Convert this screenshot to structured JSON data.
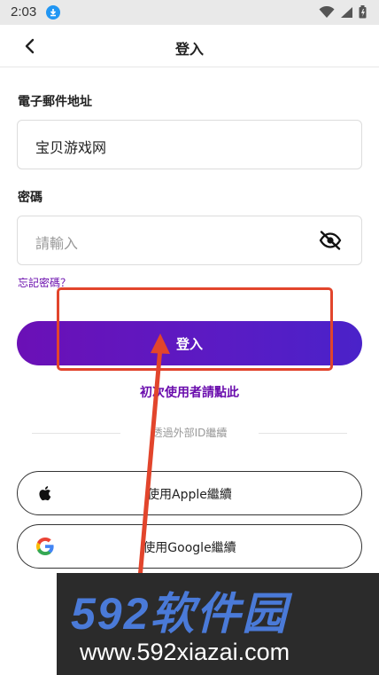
{
  "status_bar": {
    "time": "2:03"
  },
  "header": {
    "title": "登入"
  },
  "email": {
    "label": "電子郵件地址",
    "value": "宝贝游戏网"
  },
  "password": {
    "label": "密碼",
    "placeholder": "請輸入"
  },
  "forgot_password": "忘記密碼？",
  "login_button": "登入",
  "first_time_link": "初次使用者請點此",
  "divider_text": "透過外部ID繼續",
  "apple_button": "使用Apple繼續",
  "google_button": "使用Google繼續",
  "watermark": {
    "brand": "592软件园",
    "url": "www.592xiazai.com"
  },
  "colors": {
    "accent": "#6a0dad",
    "annotation": "#e2452c"
  }
}
